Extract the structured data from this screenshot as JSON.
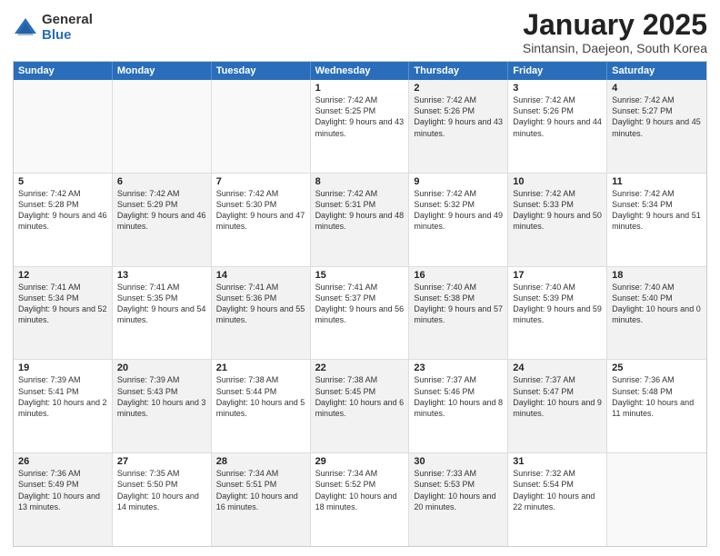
{
  "logo": {
    "general": "General",
    "blue": "Blue"
  },
  "title": "January 2025",
  "subtitle": "Sintansin, Daejeon, South Korea",
  "header_days": [
    "Sunday",
    "Monday",
    "Tuesday",
    "Wednesday",
    "Thursday",
    "Friday",
    "Saturday"
  ],
  "rows": [
    [
      {
        "day": "",
        "text": "",
        "shaded": false,
        "empty": true
      },
      {
        "day": "",
        "text": "",
        "shaded": false,
        "empty": true
      },
      {
        "day": "",
        "text": "",
        "shaded": false,
        "empty": true
      },
      {
        "day": "1",
        "text": "Sunrise: 7:42 AM\nSunset: 5:25 PM\nDaylight: 9 hours and 43 minutes.",
        "shaded": false,
        "empty": false
      },
      {
        "day": "2",
        "text": "Sunrise: 7:42 AM\nSunset: 5:26 PM\nDaylight: 9 hours and 43 minutes.",
        "shaded": true,
        "empty": false
      },
      {
        "day": "3",
        "text": "Sunrise: 7:42 AM\nSunset: 5:26 PM\nDaylight: 9 hours and 44 minutes.",
        "shaded": false,
        "empty": false
      },
      {
        "day": "4",
        "text": "Sunrise: 7:42 AM\nSunset: 5:27 PM\nDaylight: 9 hours and 45 minutes.",
        "shaded": true,
        "empty": false
      }
    ],
    [
      {
        "day": "5",
        "text": "Sunrise: 7:42 AM\nSunset: 5:28 PM\nDaylight: 9 hours and 46 minutes.",
        "shaded": false,
        "empty": false
      },
      {
        "day": "6",
        "text": "Sunrise: 7:42 AM\nSunset: 5:29 PM\nDaylight: 9 hours and 46 minutes.",
        "shaded": true,
        "empty": false
      },
      {
        "day": "7",
        "text": "Sunrise: 7:42 AM\nSunset: 5:30 PM\nDaylight: 9 hours and 47 minutes.",
        "shaded": false,
        "empty": false
      },
      {
        "day": "8",
        "text": "Sunrise: 7:42 AM\nSunset: 5:31 PM\nDaylight: 9 hours and 48 minutes.",
        "shaded": true,
        "empty": false
      },
      {
        "day": "9",
        "text": "Sunrise: 7:42 AM\nSunset: 5:32 PM\nDaylight: 9 hours and 49 minutes.",
        "shaded": false,
        "empty": false
      },
      {
        "day": "10",
        "text": "Sunrise: 7:42 AM\nSunset: 5:33 PM\nDaylight: 9 hours and 50 minutes.",
        "shaded": true,
        "empty": false
      },
      {
        "day": "11",
        "text": "Sunrise: 7:42 AM\nSunset: 5:34 PM\nDaylight: 9 hours and 51 minutes.",
        "shaded": false,
        "empty": false
      }
    ],
    [
      {
        "day": "12",
        "text": "Sunrise: 7:41 AM\nSunset: 5:34 PM\nDaylight: 9 hours and 52 minutes.",
        "shaded": true,
        "empty": false
      },
      {
        "day": "13",
        "text": "Sunrise: 7:41 AM\nSunset: 5:35 PM\nDaylight: 9 hours and 54 minutes.",
        "shaded": false,
        "empty": false
      },
      {
        "day": "14",
        "text": "Sunrise: 7:41 AM\nSunset: 5:36 PM\nDaylight: 9 hours and 55 minutes.",
        "shaded": true,
        "empty": false
      },
      {
        "day": "15",
        "text": "Sunrise: 7:41 AM\nSunset: 5:37 PM\nDaylight: 9 hours and 56 minutes.",
        "shaded": false,
        "empty": false
      },
      {
        "day": "16",
        "text": "Sunrise: 7:40 AM\nSunset: 5:38 PM\nDaylight: 9 hours and 57 minutes.",
        "shaded": true,
        "empty": false
      },
      {
        "day": "17",
        "text": "Sunrise: 7:40 AM\nSunset: 5:39 PM\nDaylight: 9 hours and 59 minutes.",
        "shaded": false,
        "empty": false
      },
      {
        "day": "18",
        "text": "Sunrise: 7:40 AM\nSunset: 5:40 PM\nDaylight: 10 hours and 0 minutes.",
        "shaded": true,
        "empty": false
      }
    ],
    [
      {
        "day": "19",
        "text": "Sunrise: 7:39 AM\nSunset: 5:41 PM\nDaylight: 10 hours and 2 minutes.",
        "shaded": false,
        "empty": false
      },
      {
        "day": "20",
        "text": "Sunrise: 7:39 AM\nSunset: 5:43 PM\nDaylight: 10 hours and 3 minutes.",
        "shaded": true,
        "empty": false
      },
      {
        "day": "21",
        "text": "Sunrise: 7:38 AM\nSunset: 5:44 PM\nDaylight: 10 hours and 5 minutes.",
        "shaded": false,
        "empty": false
      },
      {
        "day": "22",
        "text": "Sunrise: 7:38 AM\nSunset: 5:45 PM\nDaylight: 10 hours and 6 minutes.",
        "shaded": true,
        "empty": false
      },
      {
        "day": "23",
        "text": "Sunrise: 7:37 AM\nSunset: 5:46 PM\nDaylight: 10 hours and 8 minutes.",
        "shaded": false,
        "empty": false
      },
      {
        "day": "24",
        "text": "Sunrise: 7:37 AM\nSunset: 5:47 PM\nDaylight: 10 hours and 9 minutes.",
        "shaded": true,
        "empty": false
      },
      {
        "day": "25",
        "text": "Sunrise: 7:36 AM\nSunset: 5:48 PM\nDaylight: 10 hours and 11 minutes.",
        "shaded": false,
        "empty": false
      }
    ],
    [
      {
        "day": "26",
        "text": "Sunrise: 7:36 AM\nSunset: 5:49 PM\nDaylight: 10 hours and 13 minutes.",
        "shaded": true,
        "empty": false
      },
      {
        "day": "27",
        "text": "Sunrise: 7:35 AM\nSunset: 5:50 PM\nDaylight: 10 hours and 14 minutes.",
        "shaded": false,
        "empty": false
      },
      {
        "day": "28",
        "text": "Sunrise: 7:34 AM\nSunset: 5:51 PM\nDaylight: 10 hours and 16 minutes.",
        "shaded": true,
        "empty": false
      },
      {
        "day": "29",
        "text": "Sunrise: 7:34 AM\nSunset: 5:52 PM\nDaylight: 10 hours and 18 minutes.",
        "shaded": false,
        "empty": false
      },
      {
        "day": "30",
        "text": "Sunrise: 7:33 AM\nSunset: 5:53 PM\nDaylight: 10 hours and 20 minutes.",
        "shaded": true,
        "empty": false
      },
      {
        "day": "31",
        "text": "Sunrise: 7:32 AM\nSunset: 5:54 PM\nDaylight: 10 hours and 22 minutes.",
        "shaded": false,
        "empty": false
      },
      {
        "day": "",
        "text": "",
        "shaded": true,
        "empty": true
      }
    ]
  ]
}
